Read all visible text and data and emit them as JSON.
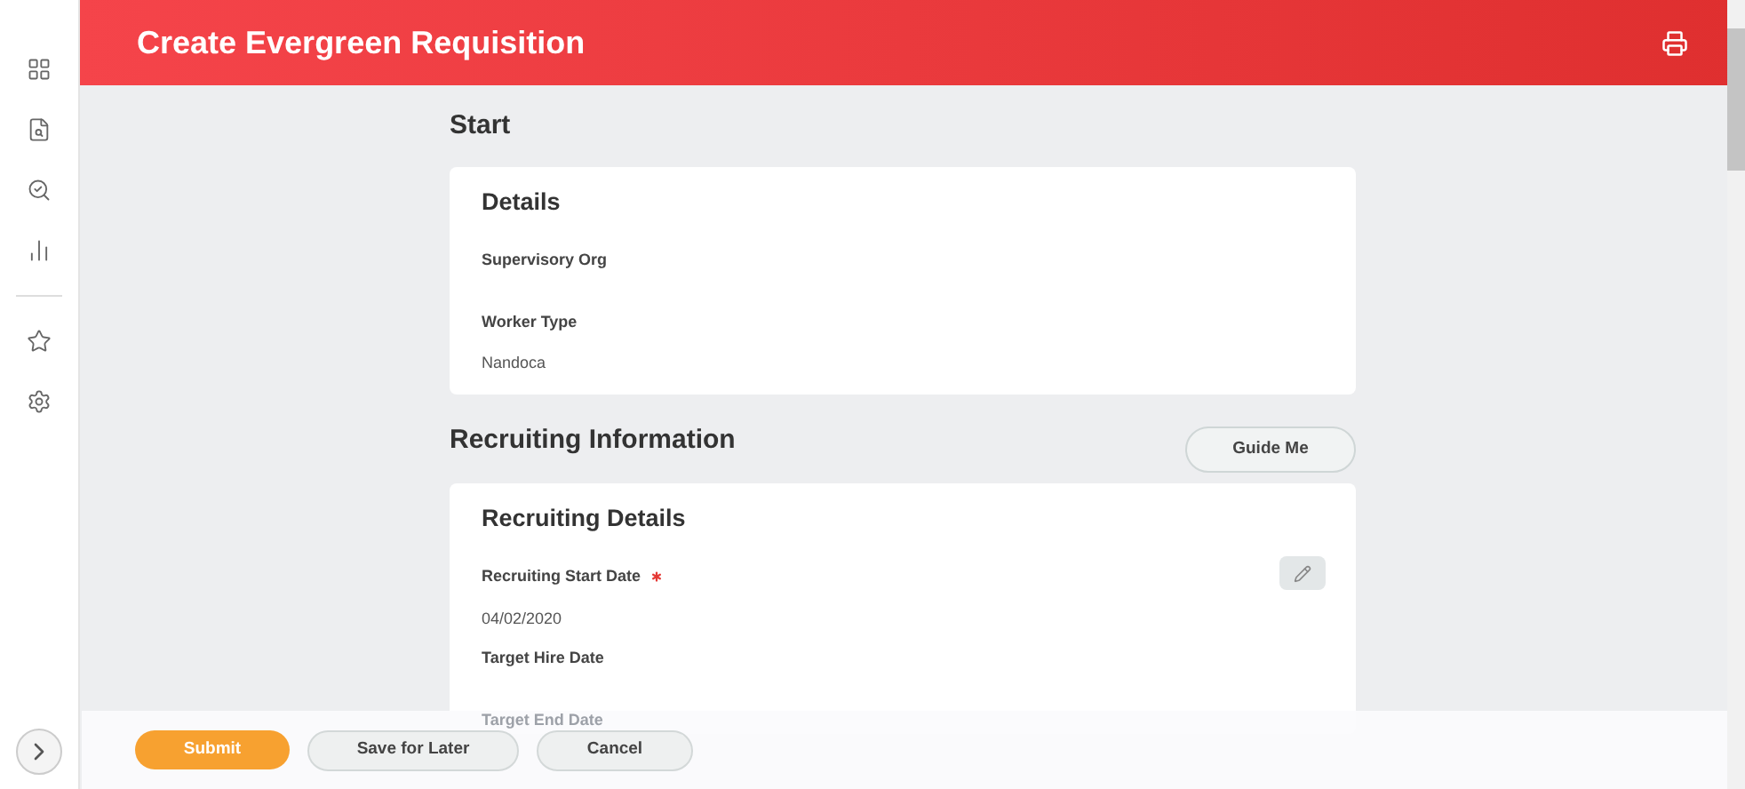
{
  "header": {
    "title": "Create Evergreen Requisition"
  },
  "sidebar": {
    "items": [
      {
        "kind": "dashboard"
      },
      {
        "kind": "profile"
      },
      {
        "kind": "search"
      },
      {
        "kind": "chart"
      },
      {
        "kind": "divider"
      },
      {
        "kind": "star"
      },
      {
        "kind": "settings"
      }
    ]
  },
  "sections": [
    {
      "title": "Start",
      "cards": [
        {
          "title": "Details",
          "editable": false,
          "fields": [
            {
              "label": "Supervisory Org",
              "required": false
            },
            {
              "label": "Worker Type",
              "value": "Nandoca",
              "required": false
            }
          ]
        }
      ]
    },
    {
      "title": "Recruiting Information",
      "action": "Guide Me",
      "cards": [
        {
          "title": "Recruiting Details",
          "editable": true,
          "fields": [
            {
              "label": "Recruiting Start Date",
              "value": "04/02/2020",
              "required": true
            },
            {
              "label": "Target Hire Date",
              "required": false
            },
            {
              "label": "Target End Date",
              "required": false
            }
          ]
        }
      ]
    }
  ],
  "footer": {
    "buttons": [
      {
        "label": "Submit",
        "kind": "primary"
      },
      {
        "label": "Save for Later",
        "kind": "secondary"
      },
      {
        "label": "Cancel",
        "kind": "secondary"
      }
    ]
  }
}
